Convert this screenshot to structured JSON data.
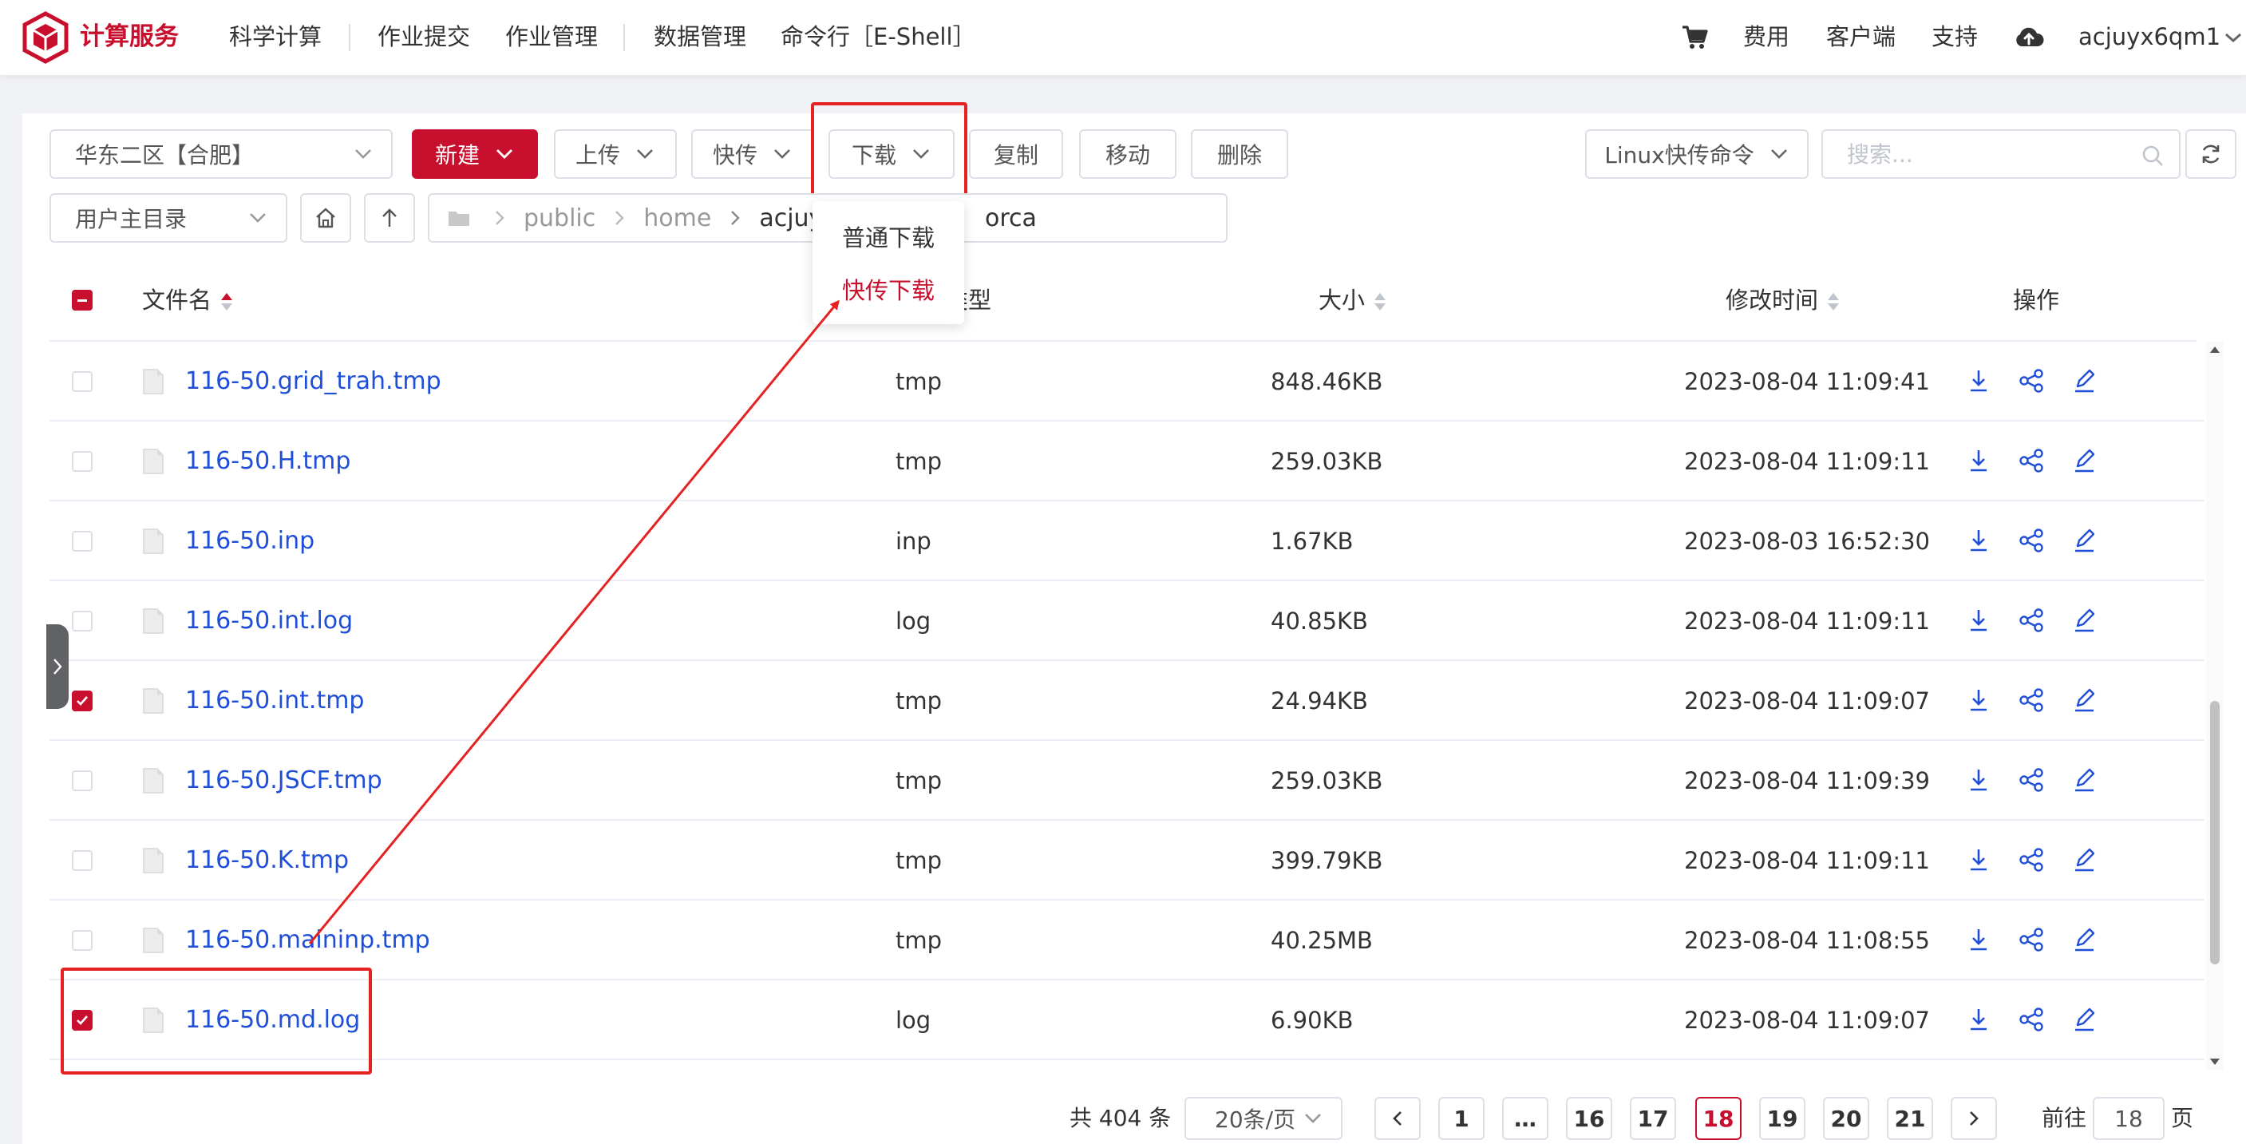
{
  "brand": {
    "name": "计算服务",
    "color": "#c8102e"
  },
  "nav": [
    "科学计算",
    "作业提交",
    "作业管理",
    "数据管理",
    "命令行［E-Shell］"
  ],
  "right_nav": {
    "cart_icon": "cart-icon",
    "fees": "费用",
    "client": "客户端",
    "support": "支持",
    "cloud_icon": "cloud-upload-icon",
    "user": "acjuyx6qm1"
  },
  "toolbar": {
    "region": "华东二区【合肥】",
    "new": "新建",
    "upload": "上传",
    "quick_transfer": "快传",
    "download": "下载",
    "copy": "复制",
    "move": "移动",
    "delete": "删除",
    "linux_cmd": "Linux快传命令",
    "search_placeholder": "搜索...",
    "dir_select": "用户主目录"
  },
  "breadcrumb": {
    "parts": [
      "public",
      "home",
      "acjuyx6c",
      "orca"
    ]
  },
  "download_menu": {
    "items": [
      "普通下载",
      "快传下载"
    ]
  },
  "table": {
    "headers": {
      "name": "文件名",
      "type": "类型",
      "size": "大小",
      "mtime": "修改时间",
      "ops": "操作"
    },
    "rows": [
      {
        "name": "116-50.grid_trah.tmp",
        "type": "tmp",
        "size": "848.46KB",
        "mtime": "2023-08-04 11:09:41",
        "checked": false
      },
      {
        "name": "116-50.H.tmp",
        "type": "tmp",
        "size": "259.03KB",
        "mtime": "2023-08-04 11:09:11",
        "checked": false
      },
      {
        "name": "116-50.inp",
        "type": "inp",
        "size": "1.67KB",
        "mtime": "2023-08-03 16:52:30",
        "checked": false
      },
      {
        "name": "116-50.int.log",
        "type": "log",
        "size": "40.85KB",
        "mtime": "2023-08-04 11:09:11",
        "checked": false
      },
      {
        "name": "116-50.int.tmp",
        "type": "tmp",
        "size": "24.94KB",
        "mtime": "2023-08-04 11:09:07",
        "checked": true
      },
      {
        "name": "116-50.JSCF.tmp",
        "type": "tmp",
        "size": "259.03KB",
        "mtime": "2023-08-04 11:09:39",
        "checked": false
      },
      {
        "name": "116-50.K.tmp",
        "type": "tmp",
        "size": "399.79KB",
        "mtime": "2023-08-04 11:09:11",
        "checked": false
      },
      {
        "name": "116-50.maininp.tmp",
        "type": "tmp",
        "size": "40.25MB",
        "mtime": "2023-08-04 11:08:55",
        "checked": false
      },
      {
        "name": "116-50.md.log",
        "type": "log",
        "size": "6.90KB",
        "mtime": "2023-08-04 11:09:07",
        "checked": true
      }
    ]
  },
  "pagination": {
    "total": "共 404 条",
    "page_size": "20条/页",
    "pages": [
      "1",
      "…",
      "16",
      "17",
      "18",
      "19",
      "20",
      "21"
    ],
    "current": "18",
    "goto_label": "前往",
    "goto_value": "18",
    "page_unit": "页"
  }
}
